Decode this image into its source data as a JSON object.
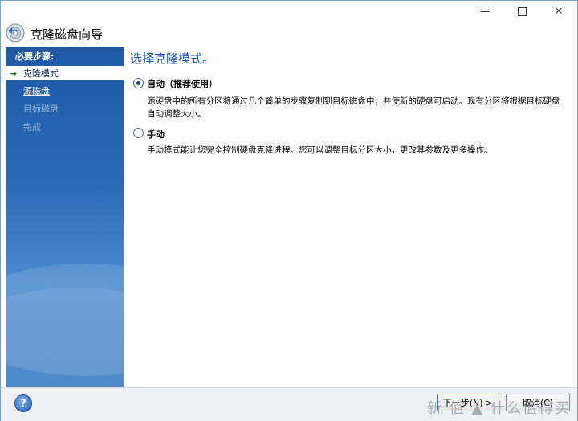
{
  "window": {
    "controls": {
      "minimize": "",
      "maximize": "",
      "close": "✕"
    }
  },
  "header": {
    "title": "克隆磁盘向导"
  },
  "sidebar": {
    "heading": "必要步骤:",
    "steps": [
      {
        "label": "克隆模式",
        "state": "current"
      },
      {
        "label": "源磁盘",
        "state": "link"
      },
      {
        "label": "目标磁盘",
        "state": "disabled"
      },
      {
        "label": "完成",
        "state": "disabled"
      }
    ],
    "footer": "可选步骤:"
  },
  "main": {
    "title": "选择克隆模式。",
    "options": [
      {
        "label": "自动（推荐使用）",
        "selected": true,
        "description": "源硬盘中的所有分区将通过几个简单的步骤复制到目标磁盘中，并使新的硬盘可启动。现有分区将根据目标硬盘自动调整大小。"
      },
      {
        "label": "手动",
        "selected": false,
        "description": "手动模式能让您完全控制硬盘克隆进程。您可以调整目标分区大小，更改其参数及更多操作。"
      }
    ]
  },
  "footer": {
    "help_icon": "?",
    "next_label": "下一步(N) >",
    "cancel_label": "取消(C)",
    "watermark": "新 值 ▲ 什么值得买"
  },
  "colors": {
    "sidebar_top": "#1f5aa6",
    "title_blue": "#1c57b6"
  }
}
